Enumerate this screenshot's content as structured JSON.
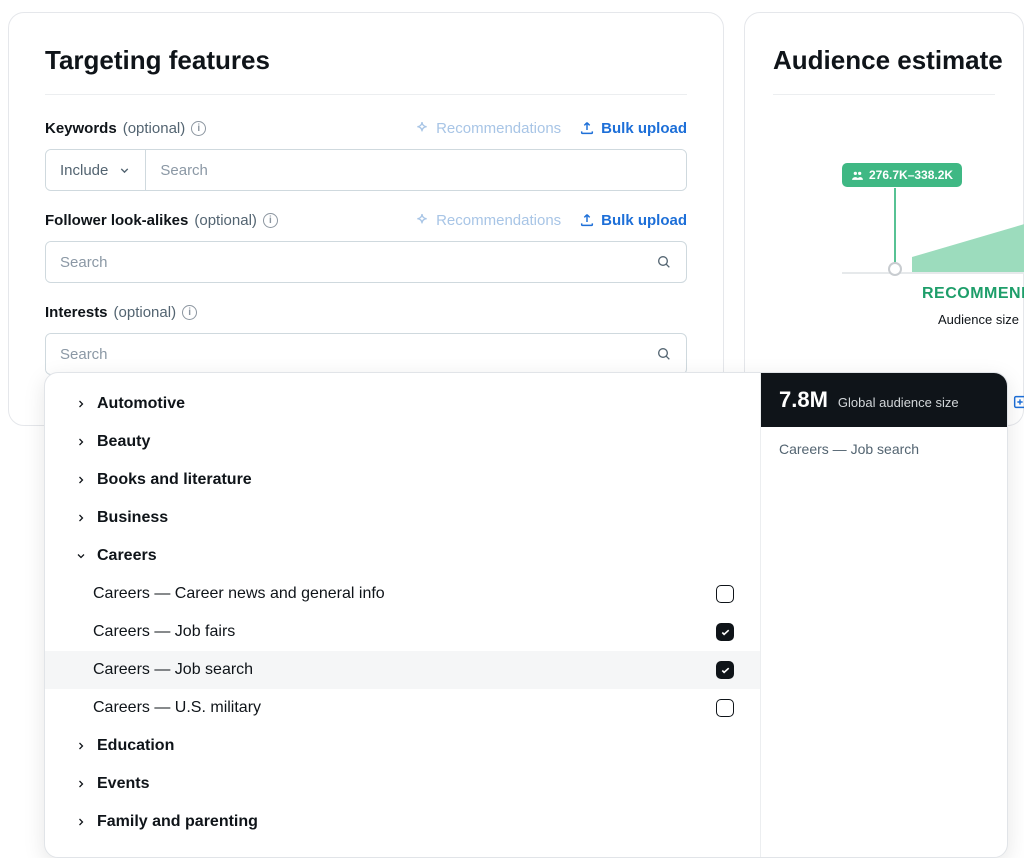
{
  "main": {
    "title": "Targeting features",
    "keywords": {
      "label": "Keywords",
      "optional": "(optional)",
      "recommendations": "Recommendations",
      "bulk_upload": "Bulk upload",
      "include": "Include",
      "search_placeholder": "Search"
    },
    "follower": {
      "label": "Follower look-alikes",
      "optional": "(optional)",
      "recommendations": "Recommendations",
      "bulk_upload": "Bulk upload",
      "search_placeholder": "Search"
    },
    "interests": {
      "label": "Interests",
      "optional": "(optional)",
      "search_placeholder": "Search"
    }
  },
  "dropdown": {
    "categories": [
      {
        "label": "Automotive",
        "expanded": false
      },
      {
        "label": "Beauty",
        "expanded": false
      },
      {
        "label": "Books and literature",
        "expanded": false
      },
      {
        "label": "Business",
        "expanded": false
      },
      {
        "label": "Careers",
        "expanded": true
      },
      {
        "label": "Education",
        "expanded": false
      },
      {
        "label": "Events",
        "expanded": false
      },
      {
        "label": "Family and parenting",
        "expanded": false
      }
    ],
    "careers_items": [
      {
        "label": "Careers — Career news and general info",
        "checked": false,
        "highlight": false
      },
      {
        "label": "Careers — Job fairs",
        "checked": true,
        "highlight": false
      },
      {
        "label": "Careers — Job search",
        "checked": true,
        "highlight": true
      },
      {
        "label": "Careers — U.S. military",
        "checked": false,
        "highlight": false
      }
    ],
    "detail": {
      "value": "7.8M",
      "label": "Global audience size",
      "breadcrumb": "Careers — Job search"
    }
  },
  "side": {
    "title": "Audience estimate",
    "range": "276.7K–338.2K",
    "recommended": "RECOMMENDED",
    "audience_size": "Audience size"
  }
}
